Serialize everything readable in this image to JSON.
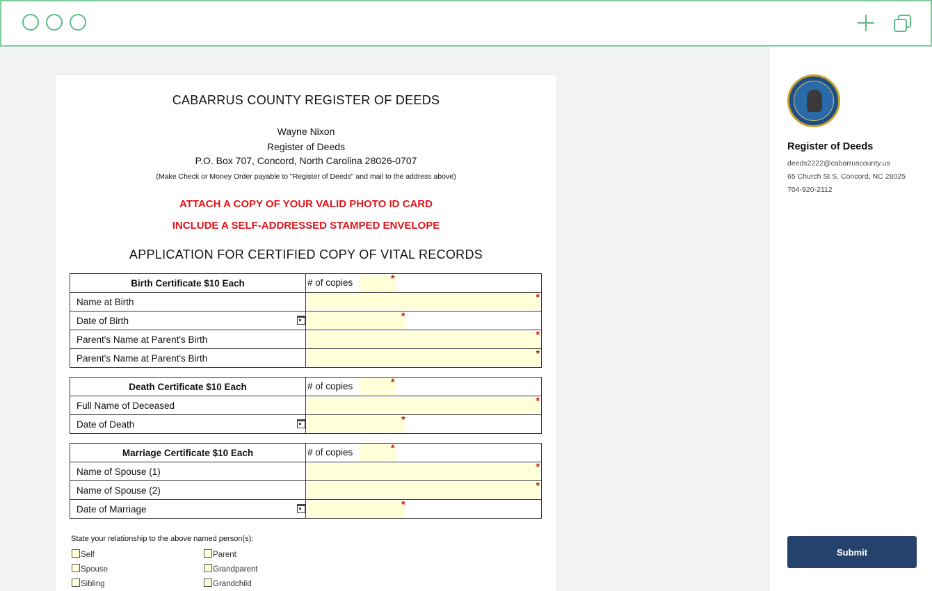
{
  "doc": {
    "title": "CABARRUS COUNTY REGISTER OF DEEDS",
    "name": "Wayne Nixon",
    "office": "Register of Deeds",
    "address": "P.O. Box 707, Concord, North Carolina 28026-0707",
    "payable_note": "(Make Check or Money Order payable to \"Register of Deeds\" and mail to the address above)",
    "notice1": "ATTACH A COPY OF YOUR VALID PHOTO ID CARD",
    "notice2": "INCLUDE A SELF-ADDRESSED STAMPED ENVELOPE",
    "app_title": "APPLICATION FOR CERTIFIED COPY OF VITAL RECORDS",
    "copies_label": "# of copies",
    "required_mark": "*",
    "birth": {
      "header": "Birth Certificate  $10 Each",
      "rows": [
        "Name at Birth",
        "Date of Birth",
        "Parent's Name at Parent's Birth",
        "Parent's Name at Parent's Birth"
      ]
    },
    "death": {
      "header": "Death Certificate  $10 Each",
      "rows": [
        "Full Name of Deceased",
        "Date of Death"
      ]
    },
    "marriage": {
      "header": "Marriage Certificate  $10 Each",
      "rows": [
        "Name of Spouse (1)",
        "Name of Spouse (2)",
        "Date of Marriage"
      ]
    },
    "relationship_label": "State your relationship to the above named person(s):",
    "relationships": [
      "Self",
      "Parent",
      "Spouse",
      "Grandparent",
      "Sibling",
      "Grandchild"
    ]
  },
  "panel": {
    "org_name": "Register of Deeds",
    "email": "deeds2222@cabarruscounty.us",
    "address": "65 Church St S, Concord, NC 28025",
    "phone": "704-920-2112",
    "submit_label": "Submit"
  },
  "colors": {
    "chrome_accent": "#5dbb84",
    "required": "#c1121f",
    "notice": "#e0141a",
    "field_fill": "#ffffd8",
    "submit": "#24426b"
  },
  "icons": [
    "circle-icon",
    "plus-icon",
    "copy-icon",
    "calendar-icon",
    "county-seal-logo"
  ]
}
